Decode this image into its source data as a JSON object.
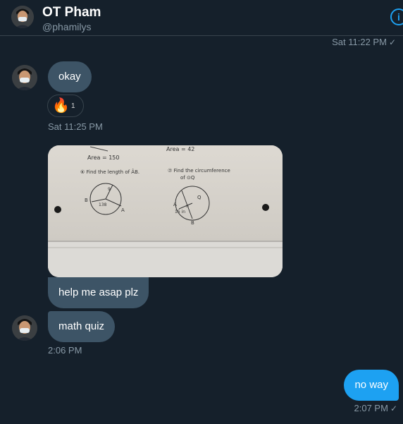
{
  "header": {
    "name": "OT Pham",
    "handle": "@phamilys",
    "info_icon": "i"
  },
  "messages": {
    "top_timestamp": "Sat 11:22 PM",
    "okay": {
      "text": "okay",
      "reaction_emoji": "🔥",
      "reaction_count": "1",
      "timestamp": "Sat 11:25 PM"
    },
    "photo": {
      "area_left": "Area = 150",
      "area_right": "Area = 42",
      "q6": "⑥ Find the length of ÂB.",
      "q7": "⑦ Find the circumference",
      "q7b": "of ⊙Q",
      "label_b": "B",
      "label_a": "A",
      "label_q": "Q",
      "label_n": "n",
      "label_138": "138",
      "label_9": "9",
      "label_15in": "15 in",
      "label_b2": "B",
      "label_a2": "A"
    },
    "help": {
      "text": "help me asap plz"
    },
    "quiz": {
      "text": "math quiz",
      "timestamp": "2:06 PM"
    },
    "own": {
      "text": "no way",
      "timestamp": "2:07 PM"
    }
  },
  "colors": {
    "background": "#15202b",
    "received_bubble": "#3d5466",
    "sent_bubble": "#1da1f2",
    "secondary_text": "#8899a6"
  }
}
